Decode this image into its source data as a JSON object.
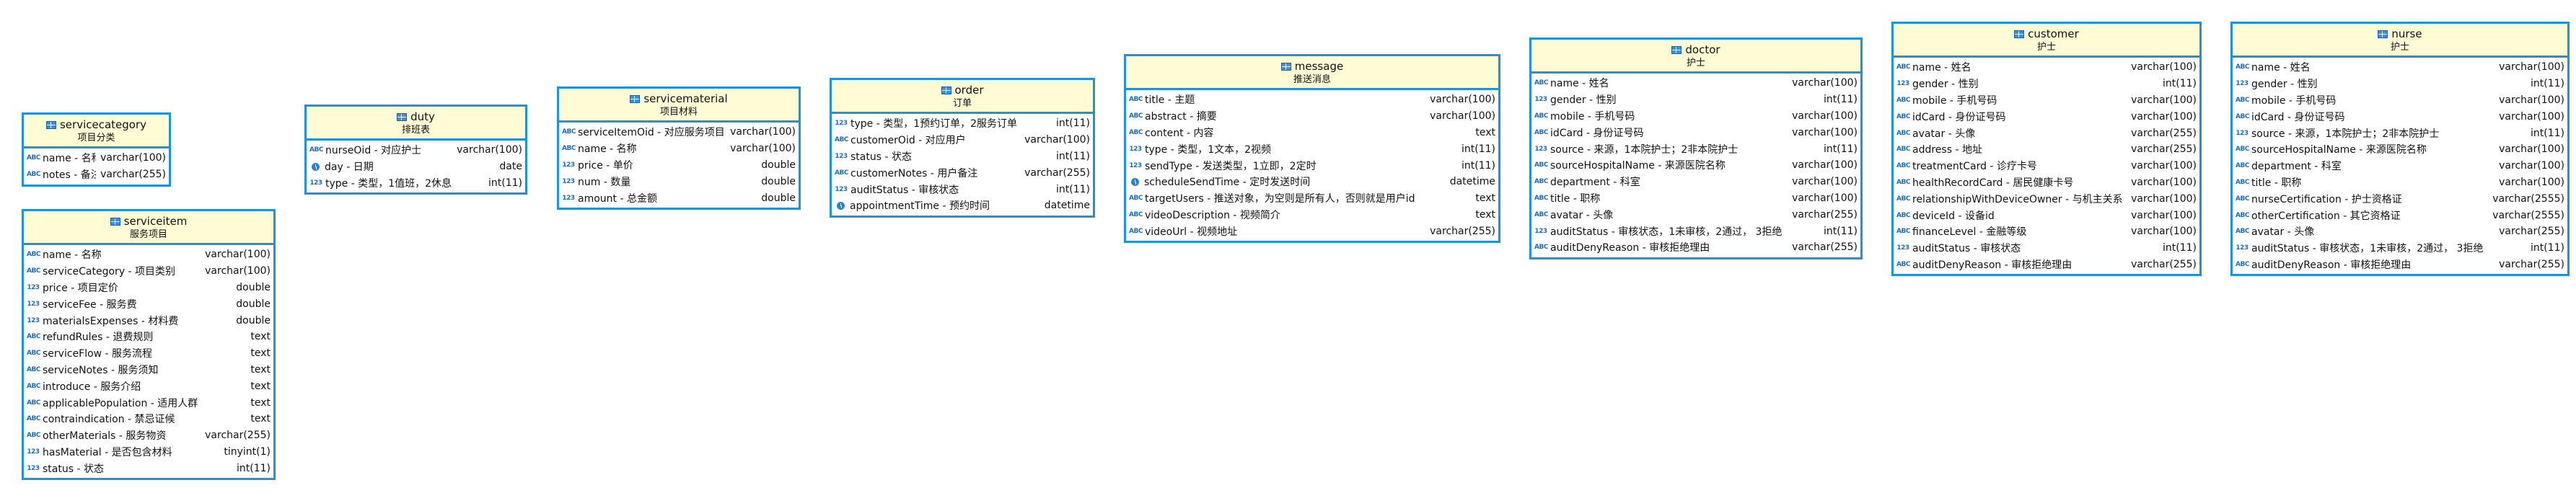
{
  "colors": {
    "border": "#1f93d6",
    "header_bg": "#fffcd5",
    "icon_blue": "#1e6ec0"
  },
  "entities": [
    {
      "key": "servicecategory",
      "name": "servicecategory",
      "comment": "项目分类",
      "columns": [
        {
          "icon": "abc",
          "name": "name - 名称",
          "type": "varchar(100)"
        },
        {
          "icon": "abc",
          "name": "notes - 备注",
          "type": "varchar(255)"
        }
      ]
    },
    {
      "key": "serviceitem",
      "name": "serviceitem",
      "comment": "服务项目",
      "columns": [
        {
          "icon": "abc",
          "name": "name - 名称",
          "type": "varchar(100)"
        },
        {
          "icon": "abc",
          "name": "serviceCategory - 项目类别",
          "type": "varchar(100)"
        },
        {
          "icon": "123",
          "name": "price - 项目定价",
          "type": "double"
        },
        {
          "icon": "123",
          "name": "serviceFee - 服务费",
          "type": "double"
        },
        {
          "icon": "123",
          "name": "materialsExpenses - 材料费",
          "type": "double"
        },
        {
          "icon": "abc",
          "name": "refundRules - 退费规则",
          "type": "text"
        },
        {
          "icon": "abc",
          "name": "serviceFlow - 服务流程",
          "type": "text"
        },
        {
          "icon": "abc",
          "name": "serviceNotes - 服务须知",
          "type": "text"
        },
        {
          "icon": "abc",
          "name": "introduce - 服务介绍",
          "type": "text"
        },
        {
          "icon": "abc",
          "name": "applicablePopulation - 适用人群",
          "type": "text"
        },
        {
          "icon": "abc",
          "name": "contraindication - 禁忌证候",
          "type": "text"
        },
        {
          "icon": "abc",
          "name": "otherMaterials - 服务物资",
          "type": "varchar(255)"
        },
        {
          "icon": "123",
          "name": "hasMaterial - 是否包含材料",
          "type": "tinyint(1)"
        },
        {
          "icon": "123",
          "name": "status - 状态",
          "type": "int(11)"
        }
      ]
    },
    {
      "key": "duty",
      "name": "duty",
      "comment": "排班表",
      "columns": [
        {
          "icon": "abc",
          "name": "nurseOid - 对应护士",
          "type": "varchar(100)"
        },
        {
          "icon": "clock",
          "name": "day - 日期",
          "type": "date"
        },
        {
          "icon": "123",
          "name": "type - 类型，1值班，2休息",
          "type": "int(11)"
        }
      ]
    },
    {
      "key": "servicematerial",
      "name": "servicematerial",
      "comment": "项目材料",
      "columns": [
        {
          "icon": "abc",
          "name": "serviceItemOid - 对应服务项目",
          "type": "varchar(100)"
        },
        {
          "icon": "abc",
          "name": "name - 名称",
          "type": "varchar(100)"
        },
        {
          "icon": "123",
          "name": "price - 单价",
          "type": "double"
        },
        {
          "icon": "123",
          "name": "num - 数量",
          "type": "double"
        },
        {
          "icon": "123",
          "name": "amount - 总金额",
          "type": "double"
        }
      ]
    },
    {
      "key": "order",
      "name": "order",
      "comment": "订单",
      "columns": [
        {
          "icon": "123",
          "name": "type - 类型，1预约订单，2服务订单",
          "type": "int(11)"
        },
        {
          "icon": "abc",
          "name": "customerOid - 对应用户",
          "type": "varchar(100)"
        },
        {
          "icon": "123",
          "name": "status - 状态",
          "type": "int(11)"
        },
        {
          "icon": "abc",
          "name": "customerNotes - 用户备注",
          "type": "varchar(255)"
        },
        {
          "icon": "123",
          "name": "auditStatus - 审核状态",
          "type": "int(11)"
        },
        {
          "icon": "clock",
          "name": "appointmentTime - 预约时间",
          "type": "datetime"
        }
      ]
    },
    {
      "key": "message",
      "name": "message",
      "comment": "推送消息",
      "columns": [
        {
          "icon": "abc",
          "name": "title - 主题",
          "type": "varchar(100)"
        },
        {
          "icon": "abc",
          "name": "abstract - 摘要",
          "type": "varchar(100)"
        },
        {
          "icon": "abc",
          "name": "content - 内容",
          "type": "text"
        },
        {
          "icon": "123",
          "name": "type - 类型，1文本，2视频",
          "type": "int(11)"
        },
        {
          "icon": "123",
          "name": "sendType - 发送类型，1立即，2定时",
          "type": "int(11)"
        },
        {
          "icon": "clock",
          "name": "scheduleSendTime - 定时发送时间",
          "type": "datetime"
        },
        {
          "icon": "abc",
          "name": "targetUsers - 推送对象，为空则是所有人，否则就是用户id",
          "type": "text"
        },
        {
          "icon": "abc",
          "name": "videoDescription - 视频简介",
          "type": "text"
        },
        {
          "icon": "abc",
          "name": "videoUrl - 视频地址",
          "type": "varchar(255)"
        }
      ]
    },
    {
      "key": "doctor",
      "name": "doctor",
      "comment": "护士",
      "columns": [
        {
          "icon": "abc",
          "name": "name - 姓名",
          "type": "varchar(100)"
        },
        {
          "icon": "123",
          "name": "gender - 性别",
          "type": "int(11)"
        },
        {
          "icon": "abc",
          "name": "mobile - 手机号码",
          "type": "varchar(100)"
        },
        {
          "icon": "abc",
          "name": "idCard - 身份证号码",
          "type": "varchar(100)"
        },
        {
          "icon": "123",
          "name": "source - 来源，1本院护士；2非本院护士",
          "type": "int(11)"
        },
        {
          "icon": "abc",
          "name": "sourceHospitalName - 来源医院名称",
          "type": "varchar(100)"
        },
        {
          "icon": "abc",
          "name": "department - 科室",
          "type": "varchar(100)"
        },
        {
          "icon": "abc",
          "name": "title - 职称",
          "type": "varchar(100)"
        },
        {
          "icon": "abc",
          "name": "avatar - 头像",
          "type": "varchar(255)"
        },
        {
          "icon": "123",
          "name": "auditStatus - 审核状态，1未审核，2通过， 3拒绝",
          "type": "int(11)"
        },
        {
          "icon": "abc",
          "name": "auditDenyReason - 审核拒绝理由",
          "type": "varchar(255)"
        }
      ]
    },
    {
      "key": "customer",
      "name": "customer",
      "comment": "护士",
      "columns": [
        {
          "icon": "abc",
          "name": "name - 姓名",
          "type": "varchar(100)"
        },
        {
          "icon": "123",
          "name": "gender - 性别",
          "type": "int(11)"
        },
        {
          "icon": "abc",
          "name": "mobile - 手机号码",
          "type": "varchar(100)"
        },
        {
          "icon": "abc",
          "name": "idCard - 身份证号码",
          "type": "varchar(100)"
        },
        {
          "icon": "abc",
          "name": "avatar - 头像",
          "type": "varchar(255)"
        },
        {
          "icon": "abc",
          "name": "address - 地址",
          "type": "varchar(255)"
        },
        {
          "icon": "abc",
          "name": "treatmentCard - 诊疗卡号",
          "type": "varchar(100)"
        },
        {
          "icon": "abc",
          "name": "healthRecordCard - 居民健康卡号",
          "type": "varchar(100)"
        },
        {
          "icon": "abc",
          "name": "relationshipWithDeviceOwner - 与机主关系",
          "type": "varchar(100)"
        },
        {
          "icon": "abc",
          "name": "deviceId - 设备id",
          "type": "varchar(100)"
        },
        {
          "icon": "abc",
          "name": "financeLevel - 金融等级",
          "type": "varchar(100)"
        },
        {
          "icon": "123",
          "name": "auditStatus - 审核状态",
          "type": "int(11)"
        },
        {
          "icon": "abc",
          "name": "auditDenyReason - 审核拒绝理由",
          "type": "varchar(255)"
        }
      ]
    },
    {
      "key": "nurse",
      "name": "nurse",
      "comment": "护士",
      "columns": [
        {
          "icon": "abc",
          "name": "name - 姓名",
          "type": "varchar(100)"
        },
        {
          "icon": "123",
          "name": "gender - 性别",
          "type": "int(11)"
        },
        {
          "icon": "abc",
          "name": "mobile - 手机号码",
          "type": "varchar(100)"
        },
        {
          "icon": "abc",
          "name": "idCard - 身份证号码",
          "type": "varchar(100)"
        },
        {
          "icon": "123",
          "name": "source - 来源，1本院护士；2非本院护士",
          "type": "int(11)"
        },
        {
          "icon": "abc",
          "name": "sourceHospitalName - 来源医院名称",
          "type": "varchar(100)"
        },
        {
          "icon": "abc",
          "name": "department - 科室",
          "type": "varchar(100)"
        },
        {
          "icon": "abc",
          "name": "title - 职称",
          "type": "varchar(100)"
        },
        {
          "icon": "abc",
          "name": "nurseCertification - 护士资格证",
          "type": "varchar(2555)"
        },
        {
          "icon": "abc",
          "name": "otherCertification - 其它资格证",
          "type": "varchar(2555)"
        },
        {
          "icon": "abc",
          "name": "avatar - 头像",
          "type": "varchar(255)"
        },
        {
          "icon": "123",
          "name": "auditStatus - 审核状态，1未审核，2通过， 3拒绝",
          "type": "int(11)"
        },
        {
          "icon": "abc",
          "name": "auditDenyReason - 审核拒绝理由",
          "type": "varchar(255)"
        }
      ]
    }
  ]
}
